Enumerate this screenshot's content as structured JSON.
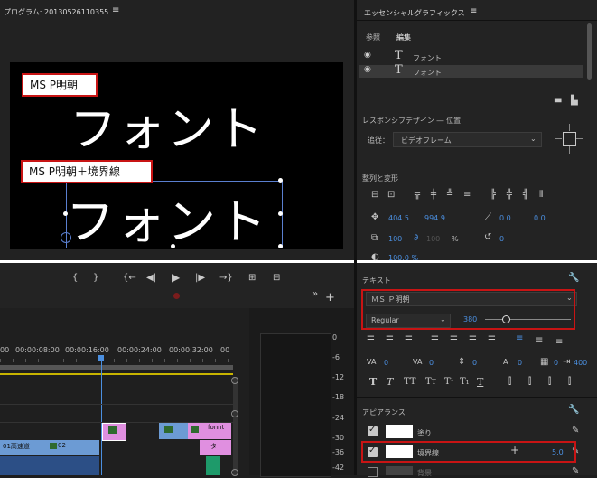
{
  "program_monitor": {
    "title": "プログラム: 20130526110355",
    "menu_icon": "hamburger-icon",
    "label1": "MS P明朝",
    "label2": "MS P明朝＋境界線",
    "text1": "フォント",
    "text2": "フォント"
  },
  "essential_graphics": {
    "title": "エッセンシャルグラフィックス",
    "tab_browse": "参照",
    "tab_edit": "編集",
    "layers": [
      "フォント",
      "フォント"
    ],
    "responsive": "レスポンシブデザイン ― 位置",
    "pin_label": "追従：",
    "pin_value": "ビデオフレーム",
    "align_title": "整列と変形",
    "pos_x": "404.5",
    "pos_y": "994.9",
    "anchor_x": "0.0",
    "anchor_y": "0.0",
    "scale": "100",
    "scale_locked": "100",
    "scale_unit": "%",
    "rotation": "0",
    "opacity": "100.0 %"
  },
  "text_panel": {
    "title": "テキスト",
    "font": "ＭＳ Ｐ明朝",
    "style": "Regular",
    "size": "380",
    "tracking": "0",
    "kerning": "0",
    "leading": "0",
    "baseline": "0",
    "tsume": "0",
    "tab_width": "400",
    "format_buttons": [
      "T",
      "T",
      "TT",
      "Tт",
      "T¹",
      "T₁",
      "T"
    ]
  },
  "appearance": {
    "title": "アピアランス",
    "fill_label": "塗り",
    "stroke_label": "境界線",
    "stroke_width": "5.0",
    "shadow_label": "背景"
  },
  "transport": {
    "markers": [
      "{",
      "}",
      "{←",
      "◀|",
      "▶",
      "|▶",
      "→}"
    ]
  },
  "timeline": {
    "times": [
      "00",
      "00:00:08:00",
      "00:00:16:00",
      "00:00:24:00",
      "00:00:32:00",
      "00"
    ],
    "clips": [
      "fonnt",
      "01高速道",
      "02",
      "タ"
    ]
  },
  "meter": {
    "ticks": [
      "0",
      "-6",
      "-12",
      "-18",
      "-24",
      "-30",
      "-36",
      "-42"
    ]
  }
}
